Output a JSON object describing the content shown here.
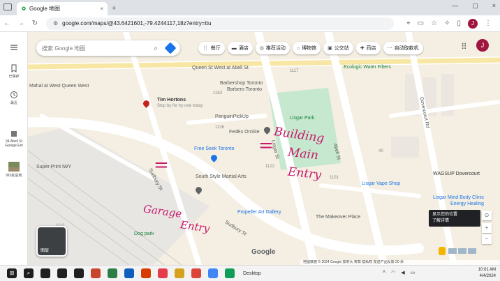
{
  "browser": {
    "tab_title": "Google 地图",
    "tab_close": "×",
    "new_tab": "+",
    "url": "google.com/maps/@43.6421601,-79.4244117,18z?entry=ttu",
    "window_controls": [
      "—",
      "▢",
      "×"
    ],
    "profile_initial": "J"
  },
  "maps": {
    "search_placeholder": "搜索 Google 地图",
    "chips": [
      {
        "icon": "restaurant-icon",
        "label": "餐厅"
      },
      {
        "icon": "hotel-icon",
        "label": "酒店"
      },
      {
        "icon": "camera-icon",
        "label": "推荐活动"
      },
      {
        "icon": "museum-icon",
        "label": "博物馆"
      },
      {
        "icon": "transit-icon",
        "label": "公交站"
      },
      {
        "icon": "pharmacy-icon",
        "label": "药店"
      },
      {
        "icon": "atm-icon",
        "label": "自动取款机"
      }
    ],
    "rail": [
      {
        "icon": "menu-icon",
        "label": ""
      },
      {
        "icon": "saved-icon",
        "label": "已保存"
      },
      {
        "icon": "history-icon",
        "label": "最近"
      },
      {
        "icon": "place-icon",
        "label": "94 Abell St Garage Ent"
      },
      {
        "icon": "photo-icon",
        "label": "WS处驻地"
      }
    ],
    "labels": {
      "queen_st": "Queen St West at Abell St",
      "queen_west": "Mahal at West Queen West",
      "tim_hortons": "Tim Hortons",
      "tim_hortons_sub": "Stop by for try one today",
      "barber": "Barbershop Toronto",
      "barbero": "Barbero Toronto",
      "ecologic": "Ecologic Water Filters",
      "lisgar_park": "Lisgar Park",
      "penguin": "PenguinPickUp",
      "fedex": "FedEx OnSite",
      "freeseek": "Free Seek Toronto",
      "southstyle": "South Style Martial Arts",
      "superprint": "Super Print IWY",
      "sudbury": "Sudbury St",
      "sudbury2": "Sudbury St",
      "lisgar_st": "Lisgar St",
      "abell_st": "Abell St",
      "dovercourt_rd": "Dovercourt Rd",
      "propeller": "Propeller Art Gallery",
      "makeover": "The Makeover Place",
      "dog_park": "Dog park",
      "lisgar_vape": "Lisgar Vape Shop",
      "wagsup": "WAGSUP Dovercourt",
      "lisgar_mind": "Lisgar Mind Body Clinic",
      "energy": "Energy Healing",
      "number_1117": "1117",
      "number_1183": "1183",
      "number_1136": "1136",
      "number_1122": "1122",
      "number_1101": "1101",
      "number_40": "40",
      "number_1112": "1112"
    },
    "annotations": {
      "building_main_entry_1": "Building",
      "building_main_entry_2": "Main",
      "building_main_entry_3": "Entry",
      "garage_entry_1": "Garage",
      "garage_entry_2": "Entry"
    },
    "layers_label": "图层",
    "google_logo": "Google",
    "tooltip_1": "显示您的位置",
    "tooltip_2": "了解详情",
    "controls": [
      "⊙",
      "+",
      "−"
    ],
    "attribution": "地图数据 © 2024 Google   加拿大   条款   隐私权   发送产品反馈   20 米"
  },
  "taskbar": {
    "desktop_label": "Desktop",
    "time": "10:01 AM",
    "date": "4/4/2024",
    "apps": [
      {
        "icon": "windows-icon",
        "color": "#1e1e1e"
      },
      {
        "icon": "search-icon",
        "color": "#1e1e1e"
      },
      {
        "icon": "app-icon",
        "color": "#202020"
      },
      {
        "icon": "app-icon",
        "color": "#202020"
      },
      {
        "icon": "app-icon",
        "color": "#202020"
      },
      {
        "icon": "app-icon",
        "color": "#c8462c"
      },
      {
        "icon": "app-icon",
        "color": "#2d7d46"
      },
      {
        "icon": "app-icon",
        "color": "#0f5dbc"
      },
      {
        "icon": "app-icon",
        "color": "#d83b01"
      },
      {
        "icon": "app-icon",
        "color": "#e43c4a"
      },
      {
        "icon": "app-icon",
        "color": "#d6a21e"
      },
      {
        "icon": "chrome-icon",
        "color": "#db4437"
      },
      {
        "icon": "app-icon",
        "color": "#4285f4"
      },
      {
        "icon": "chrome-icon",
        "color": "#0f9d58"
      }
    ]
  }
}
